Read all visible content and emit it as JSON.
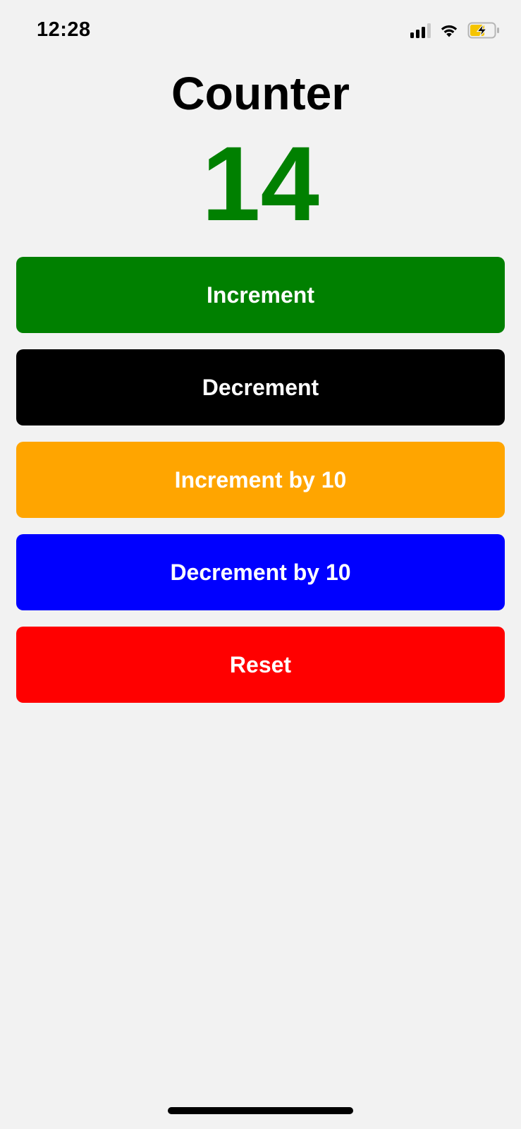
{
  "status_bar": {
    "time": "12:28",
    "icons": [
      "cellular-signal-icon",
      "wifi-icon",
      "battery-charging-icon"
    ]
  },
  "app": {
    "title": "Counter",
    "count": "14",
    "count_color": "#008000"
  },
  "buttons": [
    {
      "label": "Increment",
      "color": "#008000"
    },
    {
      "label": "Decrement",
      "color": "#000000"
    },
    {
      "label": "Increment by 10",
      "color": "#FFA500"
    },
    {
      "label": "Decrement by 10",
      "color": "#0000FF"
    },
    {
      "label": "Reset",
      "color": "#FF0000"
    }
  ],
  "battery_fill_color": "#F5C400",
  "background_color": "#F2F2F2"
}
